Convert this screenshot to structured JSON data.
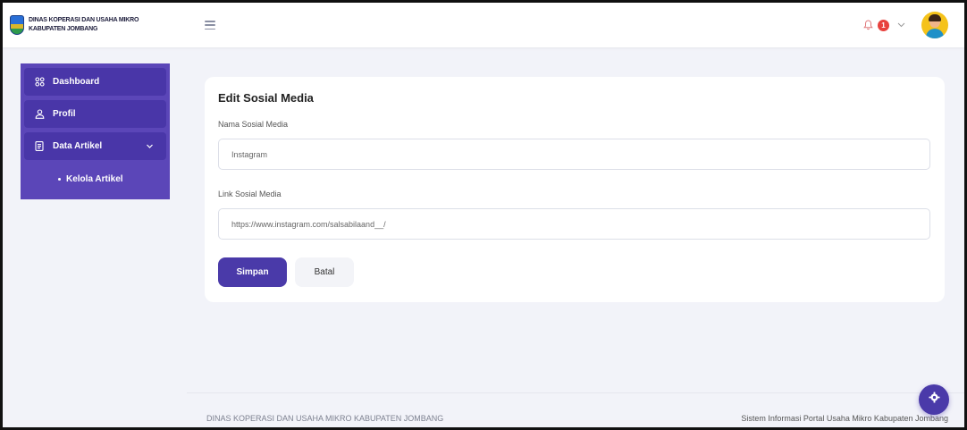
{
  "brand": {
    "line1": "DINAS KOPERASI DAN USAHA MIKRO",
    "line2": "KABUPATEN JOMBANG"
  },
  "header": {
    "notification_count": "1"
  },
  "sidebar": {
    "items": [
      {
        "label": "Dashboard",
        "icon": "grid-icon"
      },
      {
        "label": "Profil",
        "icon": "user-icon"
      },
      {
        "label": "Data Artikel",
        "icon": "document-icon"
      }
    ],
    "subitems": [
      {
        "label": "Kelola Artikel"
      }
    ]
  },
  "form": {
    "title": "Edit Sosial Media",
    "name_label": "Nama Sosial Media",
    "name_value": "Instagram",
    "link_label": "Link Sosial Media",
    "link_value": "https://www.instagram.com/salsabilaand__/",
    "save_label": "Simpan",
    "cancel_label": "Batal"
  },
  "footer": {
    "left": "DINAS KOPERASI DAN USAHA MIKRO KABUPATEN JOMBANG",
    "right": "Sistem Informasi Portal Usaha Mikro Kabupaten Jombang"
  },
  "colors": {
    "primary": "#4a3aa9",
    "sidebar": "#5b46b8",
    "badge": "#e8413d",
    "background": "#f2f3f9"
  }
}
